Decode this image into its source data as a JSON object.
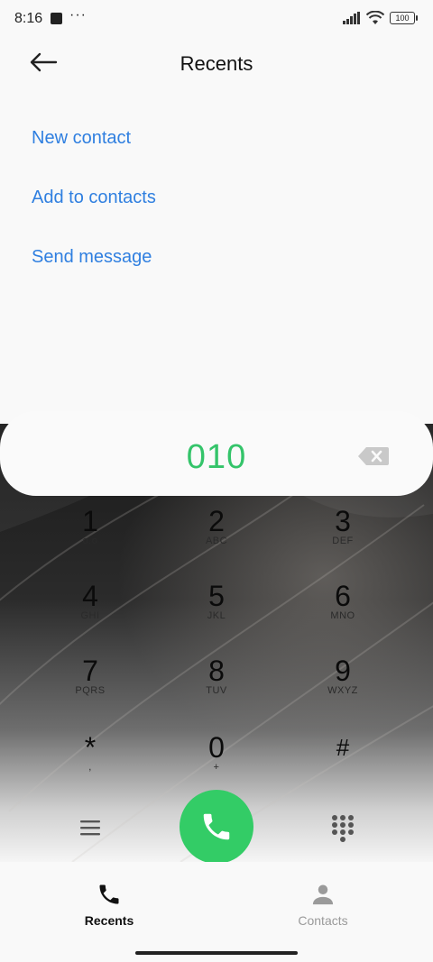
{
  "status_bar": {
    "time": "8:16",
    "more": "···",
    "battery": "100"
  },
  "header": {
    "title": "Recents"
  },
  "actions": [
    {
      "label": "New contact"
    },
    {
      "label": "Add to contacts"
    },
    {
      "label": "Send message"
    }
  ],
  "dialer": {
    "number": "010",
    "keys": [
      {
        "digit": "1",
        "letters": "o.o"
      },
      {
        "digit": "2",
        "letters": "ABC"
      },
      {
        "digit": "3",
        "letters": "DEF"
      },
      {
        "digit": "4",
        "letters": "GHI"
      },
      {
        "digit": "5",
        "letters": "JKL"
      },
      {
        "digit": "6",
        "letters": "MNO"
      },
      {
        "digit": "7",
        "letters": "PQRS"
      },
      {
        "digit": "8",
        "letters": "TUV"
      },
      {
        "digit": "9",
        "letters": "WXYZ"
      },
      {
        "digit": "*",
        "letters": ","
      },
      {
        "digit": "0",
        "letters": "+"
      },
      {
        "digit": "#",
        "letters": ""
      }
    ]
  },
  "bottom_nav": {
    "tabs": [
      {
        "label": "Recents",
        "active": true
      },
      {
        "label": "Contacts",
        "active": false
      }
    ]
  },
  "colors": {
    "accent_link": "#2f7fe0",
    "number": "#34c46a",
    "call_button": "#33cc66"
  }
}
